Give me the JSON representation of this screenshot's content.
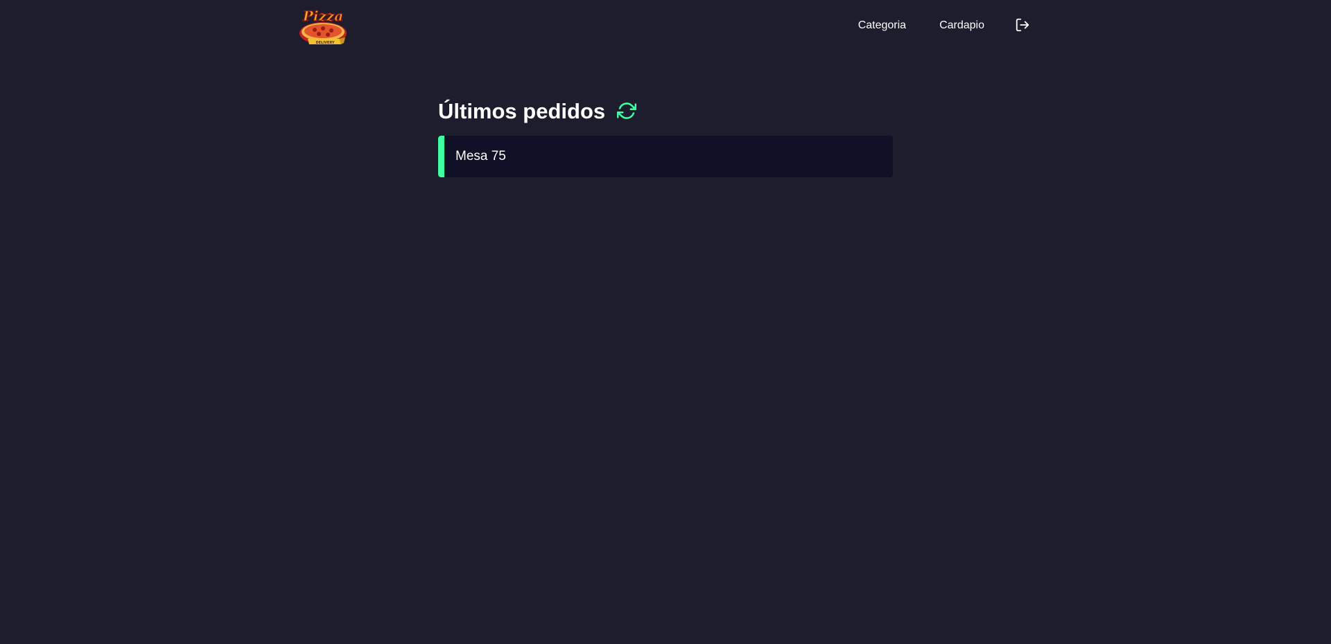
{
  "header": {
    "logo_text": "Pizza",
    "logo_subtext": "DELIVERY",
    "nav": [
      {
        "label": "Categoria"
      },
      {
        "label": "Cardapio"
      }
    ],
    "logout_icon": "logout-icon"
  },
  "main": {
    "title": "Últimos pedidos",
    "refresh_icon": "refresh-icon",
    "orders": [
      {
        "label": "Mesa 75",
        "status_color": "#3fffa3"
      }
    ]
  },
  "colors": {
    "background": "#1d1d2e",
    "card": "#101026",
    "accent": "#3fffa3"
  }
}
